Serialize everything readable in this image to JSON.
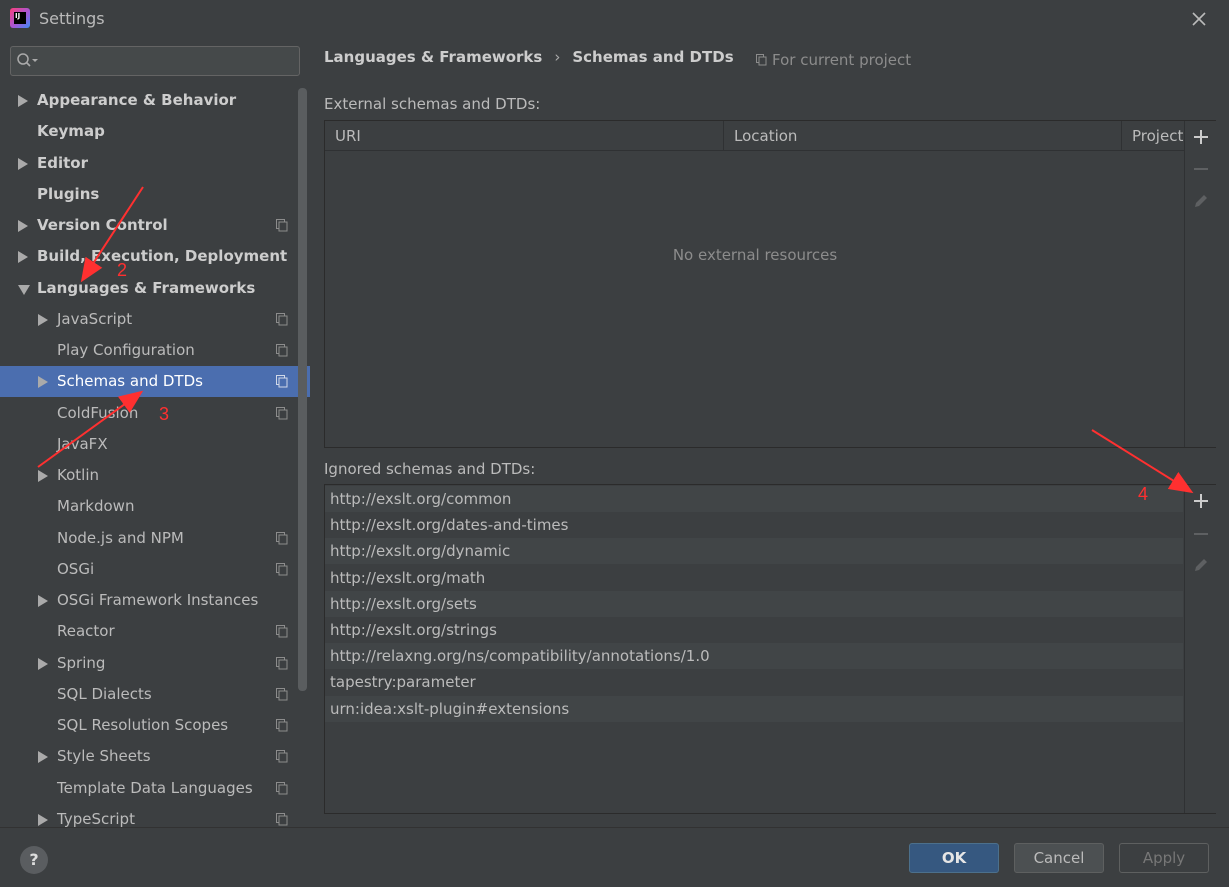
{
  "window": {
    "title": "Settings",
    "logo_text": "IJ"
  },
  "search": {
    "placeholder": ""
  },
  "sidebar": {
    "items": [
      {
        "label": "Appearance & Behavior",
        "bold": true,
        "arrow": "right",
        "indent": 0,
        "project_icon": false,
        "selected": false
      },
      {
        "label": "Keymap",
        "bold": true,
        "arrow": "none",
        "indent": 0,
        "project_icon": false,
        "selected": false
      },
      {
        "label": "Editor",
        "bold": true,
        "arrow": "right",
        "indent": 0,
        "project_icon": false,
        "selected": false
      },
      {
        "label": "Plugins",
        "bold": true,
        "arrow": "none",
        "indent": 0,
        "project_icon": false,
        "selected": false
      },
      {
        "label": "Version Control",
        "bold": true,
        "arrow": "right",
        "indent": 0,
        "project_icon": true,
        "selected": false
      },
      {
        "label": "Build, Execution, Deployment",
        "bold": true,
        "arrow": "right",
        "indent": 0,
        "project_icon": false,
        "selected": false
      },
      {
        "label": "Languages & Frameworks",
        "bold": true,
        "arrow": "down",
        "indent": 0,
        "project_icon": false,
        "selected": false
      },
      {
        "label": "JavaScript",
        "bold": false,
        "arrow": "right",
        "indent": 1,
        "project_icon": true,
        "selected": false
      },
      {
        "label": "Play Configuration",
        "bold": false,
        "arrow": "none",
        "indent": 1,
        "project_icon": true,
        "selected": false
      },
      {
        "label": "Schemas and DTDs",
        "bold": false,
        "arrow": "right",
        "indent": 1,
        "project_icon": true,
        "selected": true
      },
      {
        "label": "ColdFusion",
        "bold": false,
        "arrow": "none",
        "indent": 1,
        "project_icon": true,
        "selected": false
      },
      {
        "label": "JavaFX",
        "bold": false,
        "arrow": "none",
        "indent": 1,
        "project_icon": false,
        "selected": false
      },
      {
        "label": "Kotlin",
        "bold": false,
        "arrow": "right",
        "indent": 1,
        "project_icon": false,
        "selected": false
      },
      {
        "label": "Markdown",
        "bold": false,
        "arrow": "none",
        "indent": 1,
        "project_icon": false,
        "selected": false
      },
      {
        "label": "Node.js and NPM",
        "bold": false,
        "arrow": "none",
        "indent": 1,
        "project_icon": true,
        "selected": false
      },
      {
        "label": "OSGi",
        "bold": false,
        "arrow": "none",
        "indent": 1,
        "project_icon": true,
        "selected": false
      },
      {
        "label": "OSGi Framework Instances",
        "bold": false,
        "arrow": "right",
        "indent": 1,
        "project_icon": false,
        "selected": false
      },
      {
        "label": "Reactor",
        "bold": false,
        "arrow": "none",
        "indent": 1,
        "project_icon": true,
        "selected": false
      },
      {
        "label": "Spring",
        "bold": false,
        "arrow": "right",
        "indent": 1,
        "project_icon": true,
        "selected": false
      },
      {
        "label": "SQL Dialects",
        "bold": false,
        "arrow": "none",
        "indent": 1,
        "project_icon": true,
        "selected": false
      },
      {
        "label": "SQL Resolution Scopes",
        "bold": false,
        "arrow": "none",
        "indent": 1,
        "project_icon": true,
        "selected": false
      },
      {
        "label": "Style Sheets",
        "bold": false,
        "arrow": "right",
        "indent": 1,
        "project_icon": true,
        "selected": false
      },
      {
        "label": "Template Data Languages",
        "bold": false,
        "arrow": "none",
        "indent": 1,
        "project_icon": true,
        "selected": false
      },
      {
        "label": "TypeScript",
        "bold": false,
        "arrow": "right",
        "indent": 1,
        "project_icon": true,
        "selected": false
      }
    ]
  },
  "breadcrumb": {
    "parent": "Languages & Frameworks",
    "separator": "›",
    "current": "Schemas and DTDs"
  },
  "scope_note": "For current project",
  "external": {
    "label": "External schemas and DTDs:",
    "columns": [
      "URI",
      "Location",
      "Project"
    ],
    "empty_text": "No external resources"
  },
  "ignored": {
    "label": "Ignored schemas and DTDs:",
    "rows": [
      "http://exslt.org/common",
      "http://exslt.org/dates-and-times",
      "http://exslt.org/dynamic",
      "http://exslt.org/math",
      "http://exslt.org/sets",
      "http://exslt.org/strings",
      "http://relaxng.org/ns/compatibility/annotations/1.0",
      "tapestry:parameter",
      "urn:idea:xslt-plugin#extensions"
    ]
  },
  "buttons": {
    "help": "?",
    "ok": "OK",
    "cancel": "Cancel",
    "apply": "Apply"
  },
  "annotations": [
    "2",
    "3",
    "4"
  ],
  "colors": {
    "selection": "#4b6eaf",
    "background": "#3c3f41",
    "annotation": "#ff3030",
    "ok_button": "#365880"
  }
}
